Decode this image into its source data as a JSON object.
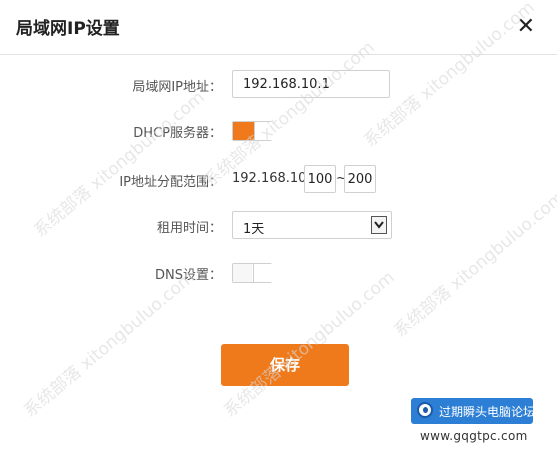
{
  "dialog": {
    "title": "局域网IP设置",
    "close_glyph": "✕"
  },
  "fields": {
    "lan_ip": {
      "label": "局域网IP地址：",
      "value": "192.168.10.1"
    },
    "dhcp": {
      "label": "DHCP服务器：",
      "state": "on"
    },
    "ip_range": {
      "label": "IP地址分配范围：",
      "prefix": "192.168.10.",
      "start": "100",
      "sep": "~",
      "end": "200"
    },
    "lease": {
      "label": "租用时间：",
      "value": "1天"
    },
    "dns": {
      "label": "DNS设置：",
      "state": "off"
    }
  },
  "save_label": "保存",
  "colors": {
    "accent": "#ef7a1c",
    "badge": "#2c7fd4"
  },
  "watermark_text": "系统部落 xitongbuluo.com",
  "badge": {
    "text": "过期瞬头电脑论坛",
    "url": "www.gqgtpc.com"
  }
}
